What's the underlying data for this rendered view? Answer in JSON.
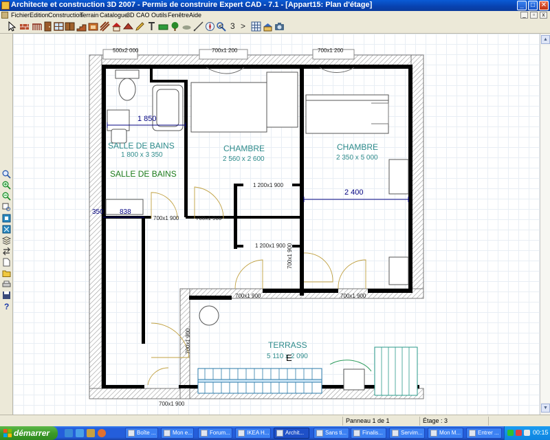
{
  "window": {
    "title": "Architecte et construction 3D 2007 - Permis de construire Expert CAD - 7.1 - [Appart15: Plan d'étage]",
    "controls": {
      "minimize": "_",
      "maximize": "□",
      "close": "✕"
    }
  },
  "menu": [
    "Fichier",
    "Edition",
    "Construction",
    "Terrain",
    "Catalogue",
    "3D",
    "CAO",
    "Outils",
    "Fenêtre",
    "Aide"
  ],
  "toolbar": {
    "page_number": "3",
    "prev": "<",
    "next": ">"
  },
  "plan": {
    "windows_top": [
      "500x2 000",
      "700x1 200",
      "700x1 200"
    ],
    "rooms": [
      {
        "name": "SALLE DE BAINS",
        "dims": "1 800 x 3 350"
      },
      {
        "name": "CHAMBRE",
        "dims": "2 560 x 2 600"
      },
      {
        "name": "CHAMBRE",
        "dims": "2 350 x 5 000"
      },
      {
        "name": "TERRASS",
        "dims": "5 110 x 2 090"
      }
    ],
    "room_label_green": "SALLE DE BAINS",
    "dimensions": {
      "bath_width": "1 850",
      "bedroom2_width": "2 400",
      "left_small": "350",
      "left_838": "838"
    },
    "doors": {
      "bath": "700x1 900",
      "bedroom1": "700x1 900",
      "closet_top": "1 200x1 900",
      "closet_bottom": "1 200x1 900",
      "hall_vertical": "700x1 900",
      "terrace_left": "700x1 900",
      "terrace_right": "700x1 900",
      "lower_vertical": "700x1 900",
      "bottom": "700x1 900"
    },
    "terrace_letter": "E"
  },
  "statusbar": {
    "panel": "Panneau 1 de 1",
    "floor": "Étage : 3"
  },
  "taskbar": {
    "start": "démarrer",
    "items": [
      {
        "label": "Boîte ...",
        "active": false
      },
      {
        "label": "Mon e...",
        "active": false
      },
      {
        "label": "Forum...",
        "active": false
      },
      {
        "label": "IKEA H...",
        "active": false
      },
      {
        "label": "Archit...",
        "active": true
      },
      {
        "label": "Sans ti...",
        "active": false
      },
      {
        "label": "Finalis...",
        "active": false
      },
      {
        "label": "Servim...",
        "active": false
      },
      {
        "label": "Mon M...",
        "active": false
      },
      {
        "label": "Entrer ...",
        "active": false
      }
    ],
    "clock": "00:15"
  },
  "colors": {
    "room_label": "#2e8b8b",
    "green_label": "#1a7a1a",
    "dimension": "#000080",
    "wall": "#000000"
  }
}
